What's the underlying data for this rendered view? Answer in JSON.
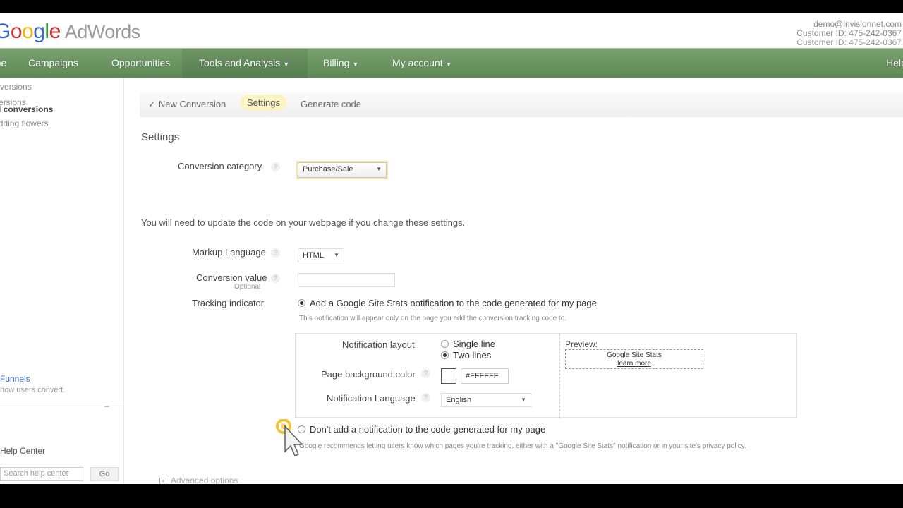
{
  "header": {
    "logo_parts": [
      "G",
      "o",
      "o",
      "g",
      "l",
      "e"
    ],
    "product": "AdWords",
    "account_email": "demo@invisionnet.com",
    "customer_id": "Customer ID: 475-242-0367"
  },
  "nav": {
    "items": [
      {
        "label": "Home"
      },
      {
        "label": "Campaigns"
      },
      {
        "label": "Opportunities"
      },
      {
        "label": "Tools and Analysis"
      },
      {
        "label": "Billing"
      },
      {
        "label": "My account"
      },
      {
        "label": "Help"
      }
    ]
  },
  "sidebar": {
    "links": [
      "Conversions",
      "Conversions",
      "All conversions",
      "Wedding flowers"
    ],
    "funnels_title": "Funnels",
    "funnels_desc": "how users convert.",
    "help_center": "Help Center",
    "search_placeholder": "Search help center",
    "go_label": "Go",
    "minimize": "–"
  },
  "steps": {
    "new_conversion": "New Conversion",
    "settings": "Settings",
    "generate_code": "Generate code"
  },
  "settings": {
    "title": "Settings",
    "conversion_category_label": "Conversion category",
    "conversion_category_value": "Purchase/Sale",
    "notice": "You will need to update the code on your webpage if you change these settings.",
    "markup_language_label": "Markup Language",
    "markup_language_value": "HTML",
    "conversion_value_label": "Conversion value",
    "conversion_value_hint": "Optional",
    "tracking_indicator_label": "Tracking indicator",
    "tracking_option_add": "Add a Google Site Stats notification to the code generated for my page",
    "tracking_option_add_hint": "This notification will appear only on the page you add the conversion tracking code to.",
    "notification_layout_label": "Notification layout",
    "layout_single": "Single line",
    "layout_two": "Two lines",
    "page_bg_color_label": "Page background color",
    "page_bg_color_value": "#FFFFFF",
    "notification_language_label": "Notification Language",
    "notification_language_value": "English",
    "preview_label": "Preview:",
    "preview_line1": "Google Site Stats",
    "preview_line2": "learn more",
    "tracking_option_dont": "Don't add a notification to the code generated for my page",
    "tracking_option_dont_hint": "Google recommends letting users know which pages you're tracking, either with a \"Google Site Stats\" notification or in your site's privacy policy.",
    "advanced_options": "Advanced options"
  },
  "colors": {
    "nav_green": "#6a9560",
    "step_highlight": "#fbf3c4",
    "link_blue": "#3366cc"
  }
}
